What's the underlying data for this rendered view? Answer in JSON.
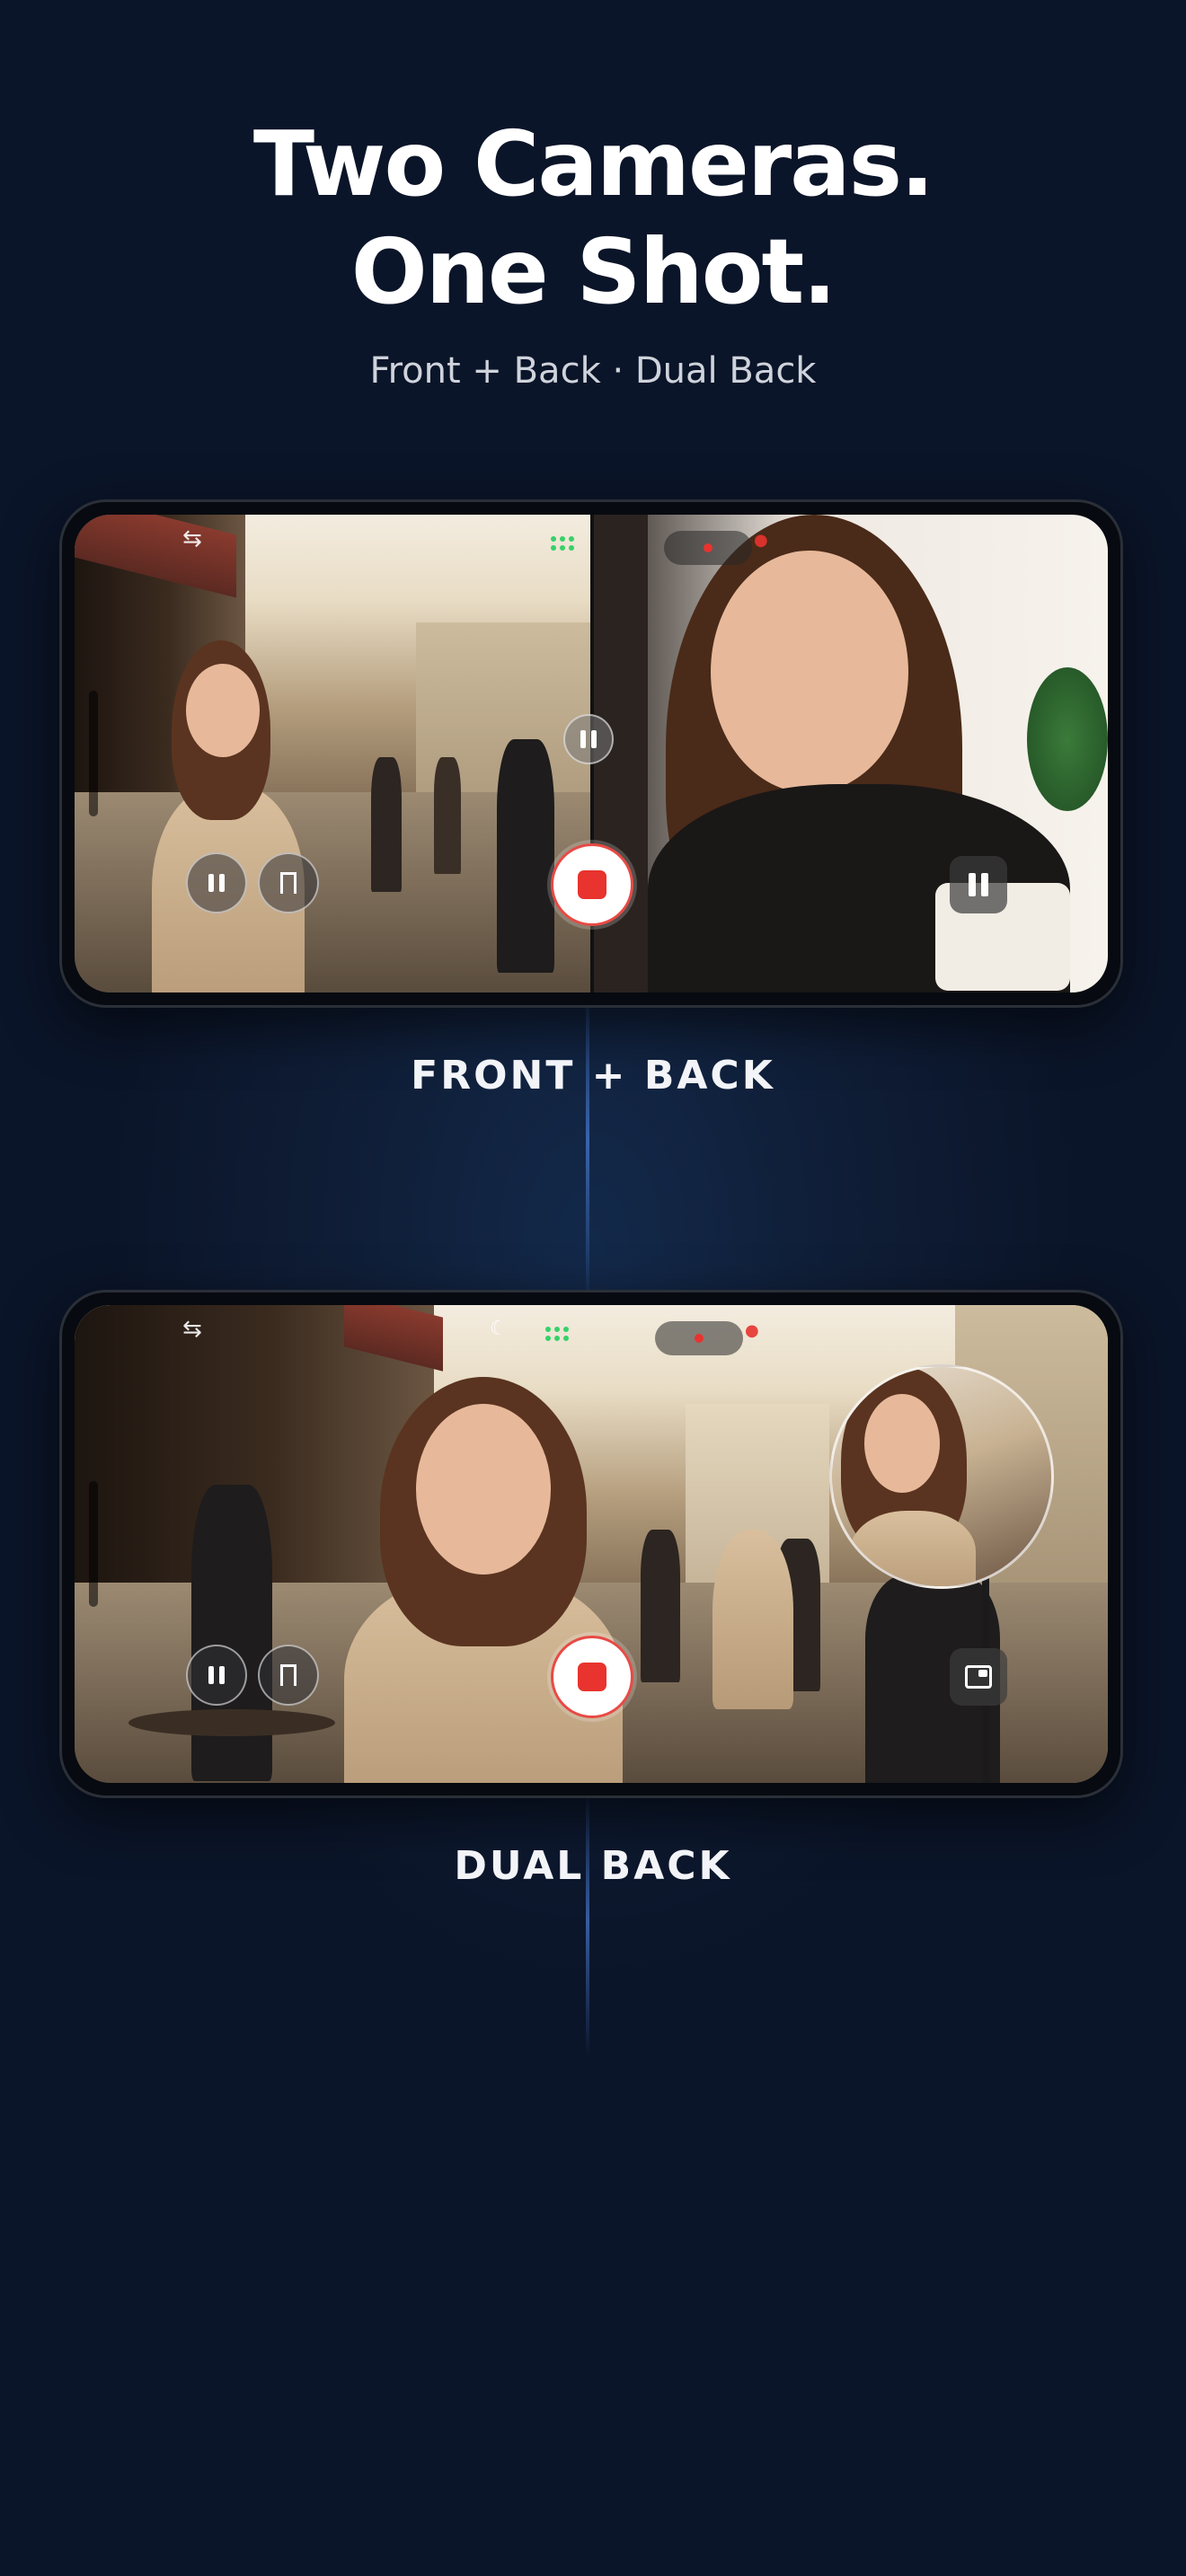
{
  "header": {
    "title_line1": "Two Cameras.",
    "title_line2": "One Shot.",
    "subtitle": "Front + Back · Dual Back"
  },
  "modes": [
    {
      "caption": "FRONT + BACK",
      "layout": "split-screen"
    },
    {
      "caption": "DUAL BACK",
      "layout": "picture-in-picture-circle"
    }
  ],
  "colors": {
    "background": "#0b1529",
    "record_red": "#e8332e",
    "indicator_green": "#36d16a"
  },
  "icons": [
    "swap-camera-icon",
    "pause-icon",
    "bookmark-icon",
    "record-icon",
    "night-mode-icon",
    "pip-toggle-icon",
    "grid-dots-icon"
  ]
}
